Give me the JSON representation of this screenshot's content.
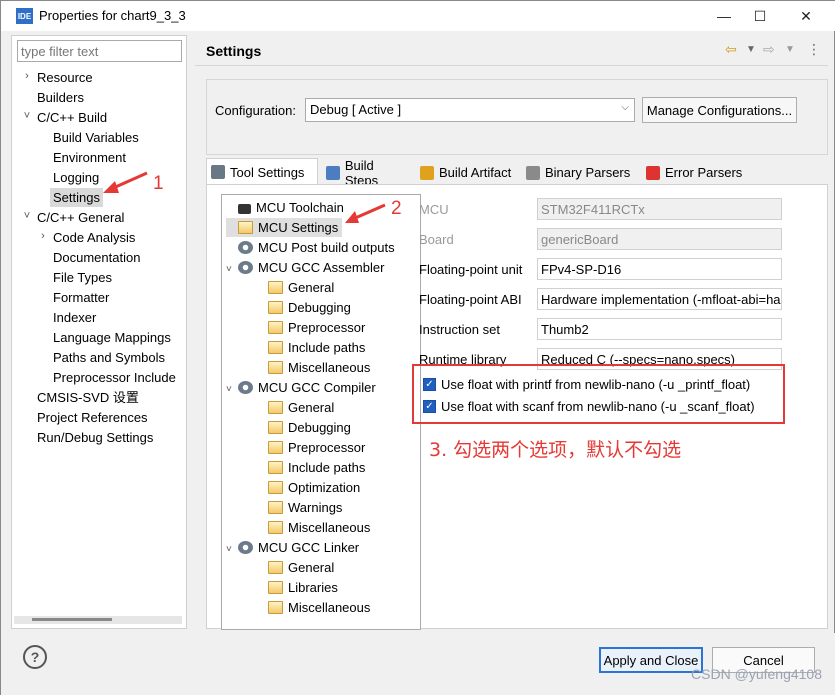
{
  "window": {
    "app_icon_text": "IDE",
    "title": "Properties for chart9_3_3"
  },
  "filter": {
    "placeholder": "type filter text"
  },
  "nav": [
    {
      "label": "Resource",
      "expander": "›",
      "level": 0
    },
    {
      "label": "Builders",
      "expander": "",
      "level": 0
    },
    {
      "label": "C/C++ Build",
      "expander": "˅",
      "level": 0
    },
    {
      "label": "Build Variables",
      "expander": "",
      "level": 1
    },
    {
      "label": "Environment",
      "expander": "",
      "level": 1
    },
    {
      "label": "Logging",
      "expander": "",
      "level": 1
    },
    {
      "label": "Settings",
      "expander": "",
      "level": 1,
      "selected": true
    },
    {
      "label": "C/C++ General",
      "expander": "˅",
      "level": 0
    },
    {
      "label": "Code Analysis",
      "expander": "›",
      "level": 1
    },
    {
      "label": "Documentation",
      "expander": "",
      "level": 1
    },
    {
      "label": "File Types",
      "expander": "",
      "level": 1
    },
    {
      "label": "Formatter",
      "expander": "",
      "level": 1
    },
    {
      "label": "Indexer",
      "expander": "",
      "level": 1
    },
    {
      "label": "Language Mappings",
      "expander": "",
      "level": 1
    },
    {
      "label": "Paths and Symbols",
      "expander": "",
      "level": 1
    },
    {
      "label": "Preprocessor Include",
      "expander": "",
      "level": 1
    },
    {
      "label": "CMSIS-SVD 设置",
      "expander": "",
      "level": 0
    },
    {
      "label": "Project References",
      "expander": "",
      "level": 0
    },
    {
      "label": "Run/Debug Settings",
      "expander": "",
      "level": 0
    }
  ],
  "settings": {
    "title": "Settings"
  },
  "configuration": {
    "label": "Configuration:",
    "value": "Debug  [ Active ]",
    "manage_label": "Manage Configurations..."
  },
  "tabs": [
    {
      "label": "Tool Settings",
      "active": true,
      "icon": "tool-settings-icon"
    },
    {
      "label": "Build Steps",
      "icon": "build-steps-icon"
    },
    {
      "label": "Build Artifact",
      "icon": "build-artifact-icon"
    },
    {
      "label": "Binary Parsers",
      "icon": "binary-parsers-icon"
    },
    {
      "label": "Error Parsers",
      "icon": "error-parsers-icon"
    }
  ],
  "tool_tree": [
    {
      "label": "MCU Toolchain",
      "icon": "chip-icon",
      "expander": ""
    },
    {
      "label": "MCU Settings",
      "icon": "folder-icon",
      "expander": "",
      "selected": true
    },
    {
      "label": "MCU Post build outputs",
      "icon": "gear-icon",
      "expander": ""
    },
    {
      "label": "MCU GCC Assembler",
      "icon": "gear-icon",
      "expander": "˅"
    },
    {
      "label": "General",
      "icon": "folder-icon",
      "child": true
    },
    {
      "label": "Debugging",
      "icon": "folder-icon",
      "child": true
    },
    {
      "label": "Preprocessor",
      "icon": "folder-icon",
      "child": true
    },
    {
      "label": "Include paths",
      "icon": "folder-icon",
      "child": true
    },
    {
      "label": "Miscellaneous",
      "icon": "folder-icon",
      "child": true
    },
    {
      "label": "MCU GCC Compiler",
      "icon": "gear-icon",
      "expander": "˅"
    },
    {
      "label": "General",
      "icon": "folder-icon",
      "child": true
    },
    {
      "label": "Debugging",
      "icon": "folder-icon",
      "child": true
    },
    {
      "label": "Preprocessor",
      "icon": "folder-icon",
      "child": true
    },
    {
      "label": "Include paths",
      "icon": "folder-icon",
      "child": true
    },
    {
      "label": "Optimization",
      "icon": "folder-icon",
      "child": true
    },
    {
      "label": "Warnings",
      "icon": "folder-icon",
      "child": true
    },
    {
      "label": "Miscellaneous",
      "icon": "folder-icon",
      "child": true
    },
    {
      "label": "MCU GCC Linker",
      "icon": "gear-icon",
      "expander": "˅"
    },
    {
      "label": "General",
      "icon": "folder-icon",
      "child": true
    },
    {
      "label": "Libraries",
      "icon": "folder-icon",
      "child": true
    },
    {
      "label": "Miscellaneous",
      "icon": "folder-icon",
      "child": true
    }
  ],
  "fields": [
    {
      "label": "MCU",
      "value": "STM32F411RCTx",
      "disabled": true
    },
    {
      "label": "Board",
      "value": "genericBoard",
      "disabled": true
    },
    {
      "label": "Floating-point unit",
      "value": "FPv4-SP-D16"
    },
    {
      "label": "Floating-point ABI",
      "value": "Hardware implementation (-mfloat-abi=hard)"
    },
    {
      "label": "Instruction set",
      "value": "Thumb2"
    },
    {
      "label": "Runtime library",
      "value": "Reduced C (--specs=nano.specs)"
    }
  ],
  "checkboxes": [
    {
      "label": "Use float with printf from newlib-nano (-u _printf_float)",
      "checked": true
    },
    {
      "label": "Use float with scanf from newlib-nano (-u _scanf_float)",
      "checked": true
    }
  ],
  "annotations": {
    "one": "1",
    "two": "2",
    "three": "3. 勾选两个选项，默认不勾选",
    "color": "#e53935"
  },
  "buttons": {
    "apply": "Apply and Close",
    "cancel": "Cancel",
    "help": "?"
  },
  "watermark": "CSDN @yufeng4108"
}
